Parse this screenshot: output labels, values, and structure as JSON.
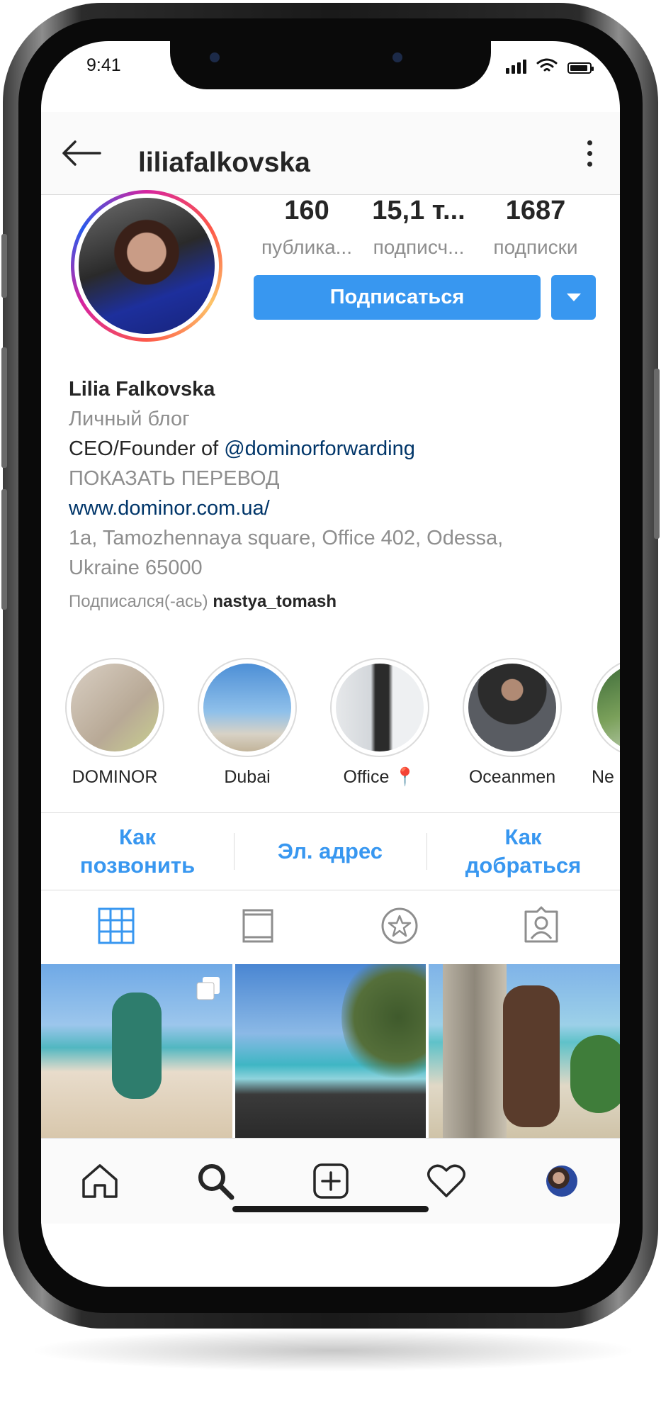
{
  "status_bar": {
    "time": "9:41"
  },
  "header": {
    "username": "liliafalkovska"
  },
  "stats": [
    {
      "value": "160",
      "label": "публика..."
    },
    {
      "value": "15,1 т...",
      "label": "подписч..."
    },
    {
      "value": "1687",
      "label": "подписки"
    }
  ],
  "follow_button": "Подписаться",
  "bio": {
    "name": "Lilia Falkovska",
    "category": "Личный блог",
    "line_prefix": "CEO/Founder of ",
    "mention": "@dominorforwarding",
    "show_translation": "ПОКАЗАТЬ ПЕРЕВОД",
    "website": "www.dominor.com.ua/",
    "address_line1": "1a, Tamozhennaya square, Office 402, Odessa,",
    "address_line2": "Ukraine 65000",
    "followed_by_prefix": "Подписался(-ась) ",
    "followed_by_user": "nastya_tomash"
  },
  "highlights": [
    "DOMINOR",
    "Dubai",
    "Office 📍",
    "Oceanmen",
    "Ne"
  ],
  "contacts": {
    "call_line1": "Как",
    "call_line2": "позвонить",
    "email": "Эл. адрес",
    "directions_line1": "Как",
    "directions_line2": "добраться"
  },
  "icons": {
    "tabs": [
      "grid-icon",
      "feed-icon",
      "saved-icon",
      "tagged-icon"
    ],
    "bottom_nav": [
      "home-icon",
      "search-icon",
      "add-post-icon",
      "heart-icon",
      "profile-avatar"
    ]
  },
  "colors": {
    "accent": "#3897f0",
    "text": "#262626",
    "secondary": "#8e8e8e",
    "link": "#003569"
  }
}
